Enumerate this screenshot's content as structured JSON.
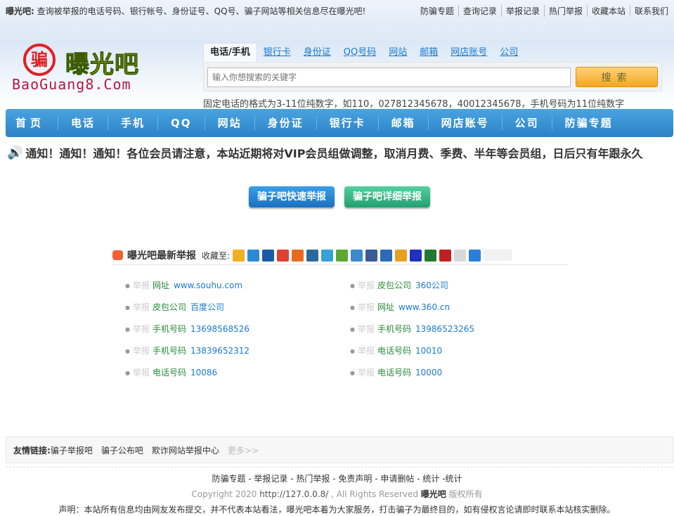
{
  "topbar": {
    "brand": "曝光吧:",
    "text": "查询被举报的电话号码、银行帐号、身份证号、QQ号、骗子网站等相关信息尽在曝光吧!",
    "links": [
      "防骗专题",
      "查询记录",
      "举报记录",
      "热门举报",
      "收藏本站",
      "联系我们"
    ]
  },
  "logo": {
    "mark": "骗",
    "name": "曝光吧",
    "url": "BaoGuang8.Com"
  },
  "search": {
    "tabs": [
      "电话/手机",
      "银行卡",
      "身份证",
      "QQ号码",
      "网站",
      "邮箱",
      "网店账号",
      "公司"
    ],
    "placeholder": "输入你想搜索的关键字",
    "button": "搜索",
    "hint": "固定电话的格式为3-11位纯数字，如110，027812345678，40012345678，手机号码为11位纯数字"
  },
  "nav": [
    "首页",
    "电话",
    "手机",
    "QQ",
    "网站",
    "身份证",
    "银行卡",
    "邮箱",
    "网店账号",
    "公司",
    "防骗专题"
  ],
  "notice": "通知！通知！通知！各位会员请注意，本站近期将对VIP会员组做调整，取消月费、季费、半年等会员组，日后只有年跟永久",
  "report_buttons": {
    "quick": "骗子吧快速举报",
    "detail": "骗子吧详细举报"
  },
  "latest": {
    "title": "曝光吧最新举报",
    "fav_label": "收藏至:",
    "share_icons": [
      {
        "name": "qzone-icon",
        "color": "#f0b020"
      },
      {
        "name": "pengyou-icon",
        "color": "#2a8ad8"
      },
      {
        "name": "renren-icon",
        "color": "#1a5aa8"
      },
      {
        "name": "weibo-icon",
        "color": "#e04030"
      },
      {
        "name": "kaixin-icon",
        "color": "#e86a20"
      },
      {
        "name": "360-icon",
        "color": "#2a6a9a"
      },
      {
        "name": "tqq-icon",
        "color": "#3aa0d8"
      },
      {
        "name": "sohu-icon",
        "color": "#5aa830"
      },
      {
        "name": "douban-board-icon",
        "color": "#3a8ad0"
      },
      {
        "name": "facebook-icon",
        "color": "#3a5a98"
      },
      {
        "name": "netease-icon",
        "color": "#2a6ab8"
      },
      {
        "name": "qqmail-icon",
        "color": "#e8a020"
      },
      {
        "name": "baidu-icon",
        "color": "#2030c0"
      },
      {
        "name": "douban-icon",
        "color": "#207a30"
      },
      {
        "name": "people-icon",
        "color": "#c02020"
      },
      {
        "name": "copy-icon",
        "color": "#d8d8d8"
      },
      {
        "name": "more-icon",
        "color": "#2a80d8"
      }
    ],
    "items": [
      {
        "label": "举报",
        "cat": "网址",
        "val": "www.souhu.com"
      },
      {
        "label": "举报",
        "cat": "皮包公司",
        "val": "360公司"
      },
      {
        "label": "举报",
        "cat": "皮包公司",
        "val": "百度公司"
      },
      {
        "label": "举报",
        "cat": "网址",
        "val": "www.360.cn"
      },
      {
        "label": "举报",
        "cat": "手机号码",
        "val": "13698568526"
      },
      {
        "label": "举报",
        "cat": "手机号码",
        "val": "13986523265"
      },
      {
        "label": "举报",
        "cat": "手机号码",
        "val": "13839652312"
      },
      {
        "label": "举报",
        "cat": "电话号码",
        "val": "10010"
      },
      {
        "label": "举报",
        "cat": "电话号码",
        "val": "10086"
      },
      {
        "label": "举报",
        "cat": "电话号码",
        "val": "10000"
      }
    ]
  },
  "friends": {
    "label": "友情链接:",
    "links": [
      "骗子举报吧",
      "骗子公布吧",
      "欺诈网站举报中心"
    ],
    "more": "更多>>"
  },
  "footer": {
    "links": [
      "防骗专题",
      "举报记录",
      "热门举报",
      "免责声明",
      "申请删帖",
      "统计",
      "统计"
    ],
    "copyright_pre": "Copyright 2020",
    "url": "http://127.0.0.8/",
    "rights": ", All Rights Reserved",
    "brand": "曝光吧",
    "owner": "版权所有",
    "disclaimer": "声明：本站所有信息均由网友发布提交，并不代表本站看法，曝光吧本着为大家服务，打击骗子为最终目的，如有侵权言论请即时联系本站核实删除。"
  }
}
